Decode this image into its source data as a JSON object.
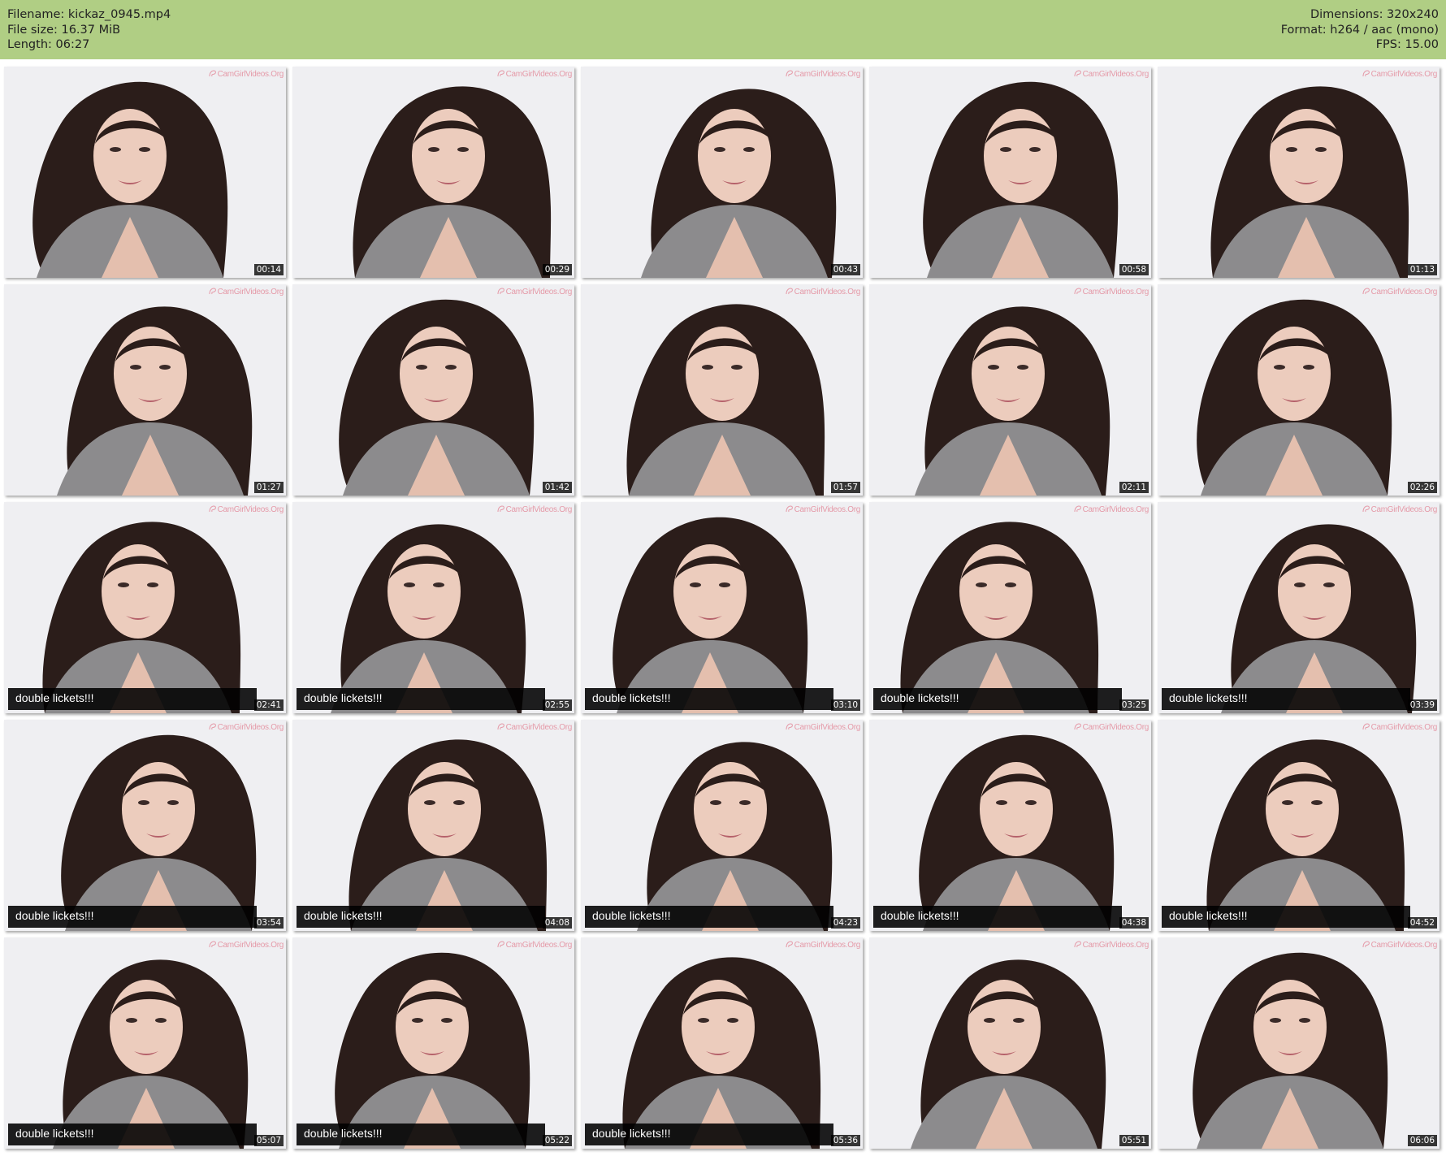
{
  "header": {
    "filename_label": "Filename: kickaz_0945.mp4",
    "filesize_label": "File size: 16.37 MiB",
    "length_label": "Length: 06:27",
    "dimensions_label": "Dimensions: 320x240",
    "format_label": "Format: h264 / aac (mono)",
    "fps_label": "FPS: 15.00",
    "background_color": "#b0ce84"
  },
  "watermark_text": "CamGirlVideos.Org",
  "caption_text": "double lickets!!!",
  "thumbnails": [
    {
      "time": "00:14",
      "caption": false
    },
    {
      "time": "00:29",
      "caption": false
    },
    {
      "time": "00:43",
      "caption": false
    },
    {
      "time": "00:58",
      "caption": false
    },
    {
      "time": "01:13",
      "caption": false
    },
    {
      "time": "01:27",
      "caption": false
    },
    {
      "time": "01:42",
      "caption": false
    },
    {
      "time": "01:57",
      "caption": false
    },
    {
      "time": "02:11",
      "caption": false
    },
    {
      "time": "02:26",
      "caption": false
    },
    {
      "time": "02:41",
      "caption": true
    },
    {
      "time": "02:55",
      "caption": true
    },
    {
      "time": "03:10",
      "caption": true
    },
    {
      "time": "03:25",
      "caption": true
    },
    {
      "time": "03:39",
      "caption": true
    },
    {
      "time": "03:54",
      "caption": true
    },
    {
      "time": "04:08",
      "caption": true
    },
    {
      "time": "04:23",
      "caption": true
    },
    {
      "time": "04:38",
      "caption": true
    },
    {
      "time": "04:52",
      "caption": true
    },
    {
      "time": "05:07",
      "caption": true
    },
    {
      "time": "05:22",
      "caption": true
    },
    {
      "time": "05:36",
      "caption": true
    },
    {
      "time": "05:51",
      "caption": false
    },
    {
      "time": "06:06",
      "caption": false
    }
  ]
}
